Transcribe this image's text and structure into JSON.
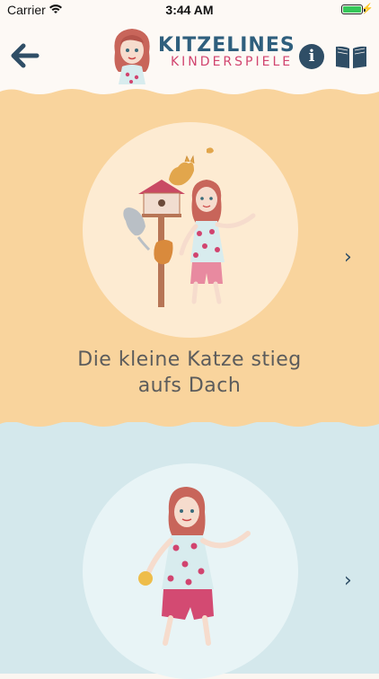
{
  "status_bar": {
    "carrier": "Carrier",
    "time": "3:44 AM",
    "battery_percent": 100
  },
  "header": {
    "brand_title": "KITZELINES",
    "brand_subtitle": "KINDERSPIELE",
    "info_label": "i",
    "colors": {
      "brand_blue": "#2f5f7d",
      "brand_pink": "#d1446f",
      "icon": "#2f4e66"
    }
  },
  "games": [
    {
      "caption_line1": "Die kleine Katze stieg",
      "caption_line2": "aufs Dach",
      "background": "#f9d49d",
      "next_label": "›"
    },
    {
      "background": "#d4e8ec",
      "next_label": "›"
    }
  ]
}
